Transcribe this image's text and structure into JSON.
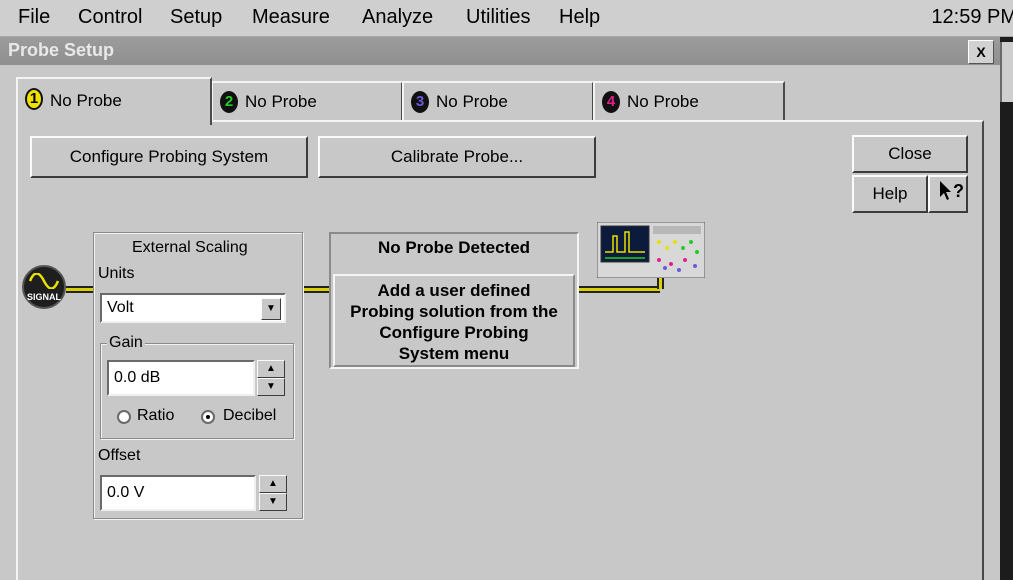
{
  "menubar": {
    "items": [
      "File",
      "Control",
      "Setup",
      "Measure",
      "Analyze",
      "Utilities",
      "Help"
    ],
    "clock": "12:59 PM"
  },
  "window": {
    "title": "Probe Setup",
    "close_label": "X"
  },
  "tabs": [
    {
      "number": "1",
      "label": "No Probe",
      "color": "#f0e000",
      "active": true
    },
    {
      "number": "2",
      "label": "No Probe",
      "color": "#22cc22",
      "active": false
    },
    {
      "number": "3",
      "label": "No Probe",
      "color": "#6a5cd8",
      "active": false
    },
    {
      "number": "4",
      "label": "No Probe",
      "color": "#e0208a",
      "active": false
    }
  ],
  "buttons": {
    "configure": "Configure Probing System",
    "calibrate": "Calibrate Probe...",
    "close": "Close",
    "help": "Help",
    "context_help": "?"
  },
  "signal": {
    "label": "SIGNAL",
    "icon": "sine-wave-icon"
  },
  "external_scaling": {
    "title": "External Scaling",
    "units_label": "Units",
    "units_value": "Volt",
    "gain": {
      "label": "Gain",
      "value": "0.0 dB",
      "options": [
        "Ratio",
        "Decibel"
      ],
      "selected": "Decibel"
    },
    "offset": {
      "label": "Offset",
      "value": "0.0 V"
    }
  },
  "probe_status": {
    "title": "No Probe Detected",
    "message": "Add a user defined Probing solution from the Configure Probing System menu"
  },
  "colors": {
    "wire": "#d8d000",
    "window_bg": "#c8c8c8"
  }
}
